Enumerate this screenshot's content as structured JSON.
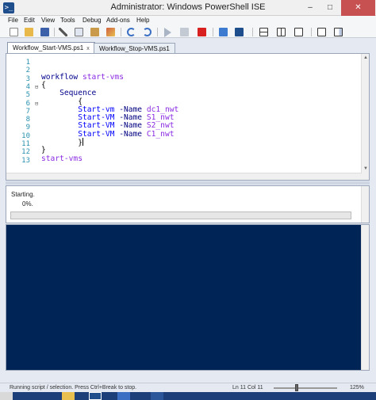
{
  "window": {
    "title": "Administrator: Windows PowerShell ISE",
    "app_icon_glyph": ">_",
    "minimize_glyph": "–",
    "maximize_glyph": "□",
    "close_glyph": "✕"
  },
  "menubar": {
    "items": [
      "File",
      "Edit",
      "View",
      "Tools",
      "Debug",
      "Add-ons",
      "Help"
    ]
  },
  "toolbar": {
    "buttons": [
      "new-script",
      "open",
      "save",
      "cut",
      "copy",
      "paste",
      "clear-console",
      "undo",
      "redo",
      "run-script",
      "run-selection",
      "stop",
      "new-remote-tab",
      "start-powershell",
      "show-script-pane-top",
      "show-script-pane-right",
      "show-script-pane-max",
      "show-command-window",
      "show-command-addon"
    ]
  },
  "tabs": [
    {
      "label": "Workflow_Start-VMS.ps1",
      "active": true,
      "close": "x"
    },
    {
      "label": "Workflow_Stop-VMS.ps1",
      "active": false,
      "close": ""
    }
  ],
  "editor": {
    "line_numbers": [
      "1",
      "2",
      "3",
      "4",
      "5",
      "6",
      "7",
      "8",
      "9",
      "10",
      "11",
      "12",
      "13"
    ],
    "fold_markers": {
      "4": "⊟",
      "6": "⊟"
    },
    "lines": [
      {
        "segments": []
      },
      {
        "segments": []
      },
      {
        "segments": [
          {
            "t": "workflow ",
            "c": "kw"
          },
          {
            "t": "start-vms",
            "c": "fn"
          }
        ]
      },
      {
        "segments": [
          {
            "t": "{",
            "c": ""
          }
        ]
      },
      {
        "segments": [
          {
            "t": "    Sequence",
            "c": "kw"
          }
        ]
      },
      {
        "segments": [
          {
            "t": "        {",
            "c": ""
          }
        ]
      },
      {
        "segments": [
          {
            "t": "        Start-vm ",
            "c": "cmd"
          },
          {
            "t": "-Name ",
            "c": "param"
          },
          {
            "t": "dc1_nwt",
            "c": "arg"
          }
        ]
      },
      {
        "segments": [
          {
            "t": "        Start-VM ",
            "c": "cmd"
          },
          {
            "t": "-Name ",
            "c": "param"
          },
          {
            "t": "S1_nwt",
            "c": "arg"
          }
        ]
      },
      {
        "segments": [
          {
            "t": "        Start-VM ",
            "c": "cmd"
          },
          {
            "t": "-Name ",
            "c": "param"
          },
          {
            "t": "S2_nwt",
            "c": "arg"
          }
        ]
      },
      {
        "segments": [
          {
            "t": "        Start-VM ",
            "c": "cmd"
          },
          {
            "t": "-Name ",
            "c": "param"
          },
          {
            "t": "C1_nwt",
            "c": "arg"
          }
        ]
      },
      {
        "segments": [
          {
            "t": "        }",
            "c": ""
          }
        ],
        "caret": true
      },
      {
        "segments": [
          {
            "t": "}",
            "c": ""
          }
        ]
      },
      {
        "segments": [
          {
            "t": "start-vms",
            "c": "fn"
          }
        ]
      }
    ]
  },
  "progress": {
    "activity": "Starting.",
    "percent_text": "0%.",
    "percent_value": 0
  },
  "statusbar": {
    "message": "Running script / selection.  Press Ctrl+Break to stop.",
    "position": "Ln 11  Col 11",
    "zoom": "125%"
  },
  "colors": {
    "console_bg": "#012456",
    "close_button": "#c75050",
    "keyword": "#00008b",
    "variable_name": "#8a2be2",
    "command": "#0000ff"
  }
}
